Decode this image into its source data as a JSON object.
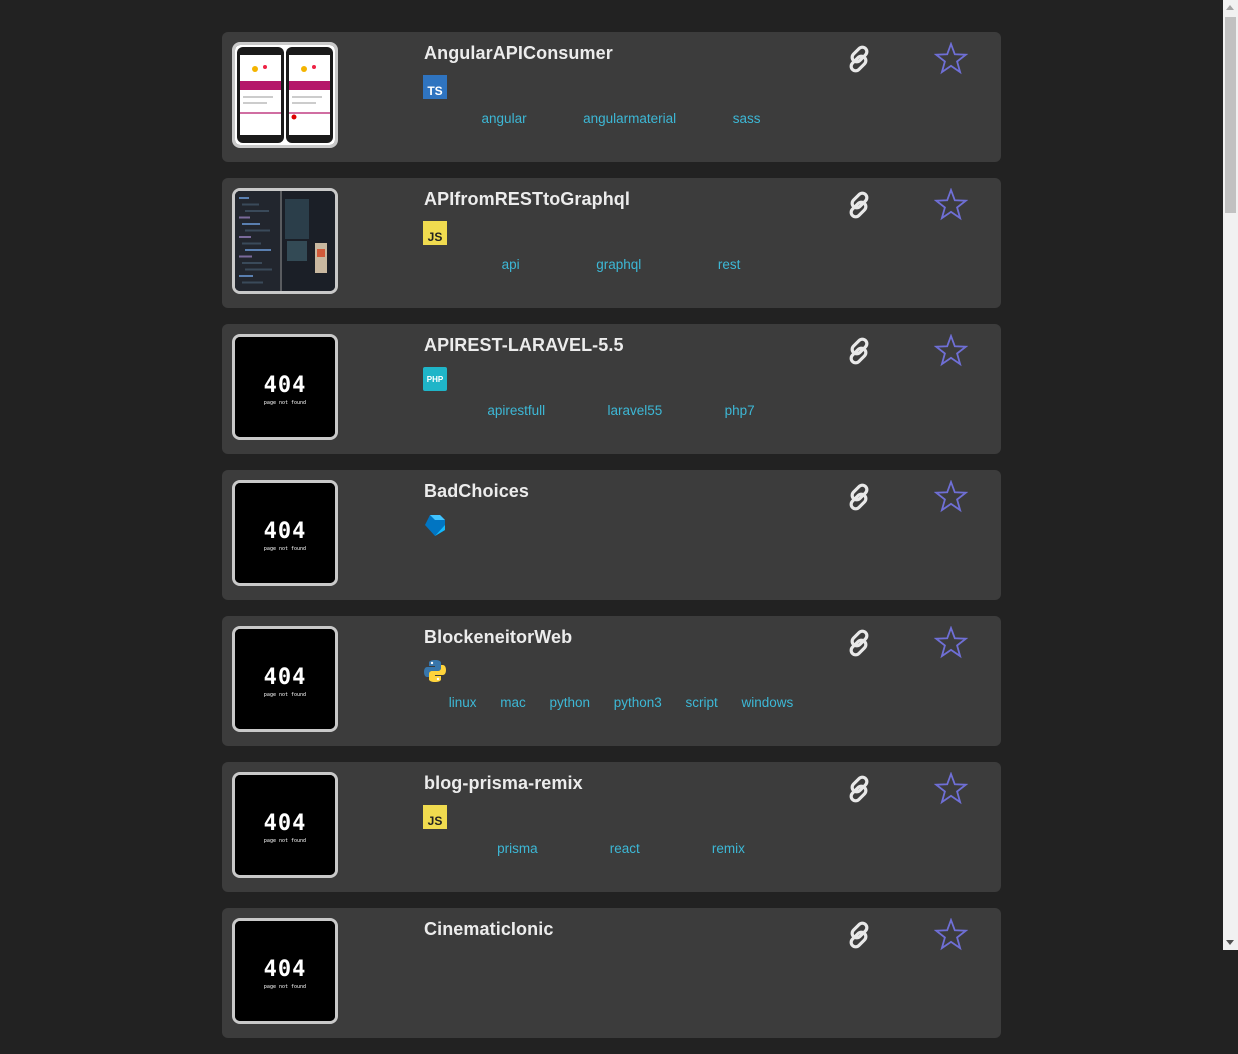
{
  "repos": [
    {
      "name": "AngularAPIConsumer",
      "lang": "ts-icon",
      "preview": "phones",
      "tags": [
        "angular",
        "angularmaterial",
        "sass"
      ]
    },
    {
      "name": "APIfromRESTtoGraphql",
      "lang": "js-icon",
      "preview": "screen",
      "tags": [
        "api",
        "graphql",
        "rest"
      ]
    },
    {
      "name": "APIREST-LARAVEL-5.5",
      "lang": "php-icon",
      "preview": "404",
      "tags": [
        "apirestfull",
        "laravel55",
        "php7"
      ]
    },
    {
      "name": "BadChoices",
      "lang": "dart-icon",
      "preview": "404",
      "tags": []
    },
    {
      "name": "BlockeneitorWeb",
      "lang": "python-icon",
      "preview": "404",
      "tags": [
        "linux",
        "mac",
        "python",
        "python3",
        "script",
        "windows"
      ]
    },
    {
      "name": "blog-prisma-remix",
      "lang": "js-icon",
      "preview": "404",
      "tags": [
        "prisma",
        "react",
        "remix"
      ]
    },
    {
      "name": "CinematicIonic",
      "lang": "",
      "preview": "404",
      "tags": []
    }
  ],
  "lang_badges": {
    "ts": "TS",
    "js": "JS",
    "php": "PHP"
  },
  "not_found": {
    "code": "404",
    "text": "page not found"
  },
  "colors": {
    "background": "#222222",
    "card": "#3c3c3c",
    "tag": "#3db8d6",
    "star": "#6f6fd6",
    "link": "#e8e8e8",
    "title": "#ececec"
  }
}
